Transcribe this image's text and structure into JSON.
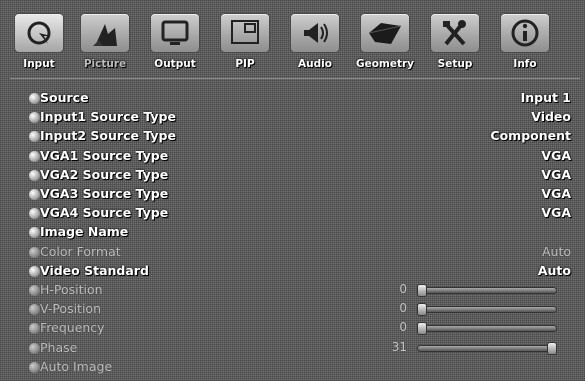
{
  "tabs": [
    {
      "label": "Input",
      "icon": "cursor-icon"
    },
    {
      "label": "Picture",
      "icon": "picture-icon"
    },
    {
      "label": "Output",
      "icon": "monitor-icon"
    },
    {
      "label": "PIP",
      "icon": "pip-icon"
    },
    {
      "label": "Audio",
      "icon": "speaker-icon"
    },
    {
      "label": "Geometry",
      "icon": "geometry-icon"
    },
    {
      "label": "Setup",
      "icon": "tools-icon"
    },
    {
      "label": "Info",
      "icon": "info-icon"
    }
  ],
  "active_tab": "Input",
  "rows": [
    {
      "label": "Source",
      "value": "Input 1",
      "dim": false
    },
    {
      "label": "Input1 Source Type",
      "value": "Video",
      "dim": false
    },
    {
      "label": "Input2 Source Type",
      "value": "Component",
      "dim": false
    },
    {
      "label": "VGA1 Source Type",
      "value": "VGA",
      "dim": false
    },
    {
      "label": "VGA2 Source Type",
      "value": "VGA",
      "dim": false
    },
    {
      "label": "VGA3 Source Type",
      "value": "VGA",
      "dim": false
    },
    {
      "label": "VGA4 Source Type",
      "value": "VGA",
      "dim": false
    },
    {
      "label": "Image Name",
      "value": "",
      "dim": false
    },
    {
      "label": "Color Format",
      "value": "Auto",
      "dim": true
    },
    {
      "label": "Video Standard",
      "value": "Auto",
      "dim": false
    },
    {
      "label": "H-Position",
      "number": "0",
      "level": 0,
      "dim": true
    },
    {
      "label": "V-Position",
      "number": "0",
      "level": 0,
      "dim": true
    },
    {
      "label": "Frequency",
      "number": "0",
      "level": 0,
      "dim": true
    },
    {
      "label": "Phase",
      "number": "31",
      "level": 1,
      "dim": true
    },
    {
      "label": "Auto Image",
      "value": "",
      "dim": true
    }
  ]
}
